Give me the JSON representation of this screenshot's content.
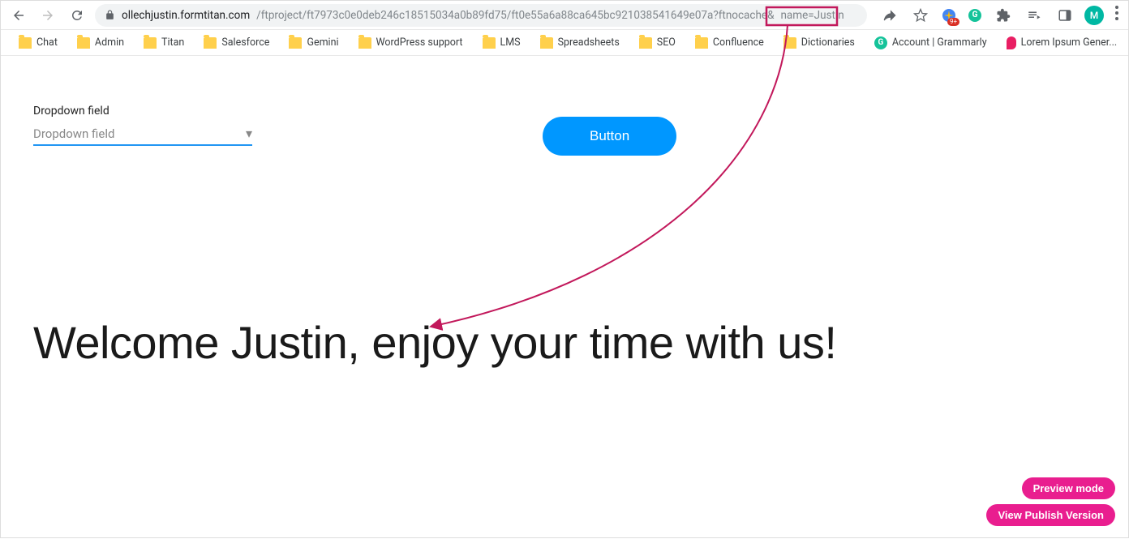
{
  "browser": {
    "url_host": "ollechjustin.formtitan.com",
    "url_path": "/ftproject/ft7973c0e0deb246c18515034a0b89fd75/ft0e55a6a88ca645bc921038541649e07a?ftnocache&",
    "url_query_highlight": "name=Justin",
    "avatar_initial": "M",
    "ext_badge": "9+"
  },
  "bookmarks": [
    {
      "label": "Chat",
      "icon": "folder"
    },
    {
      "label": "Admin",
      "icon": "folder"
    },
    {
      "label": "Titan",
      "icon": "folder"
    },
    {
      "label": "Salesforce",
      "icon": "folder"
    },
    {
      "label": "Gemini",
      "icon": "folder"
    },
    {
      "label": "WordPress support",
      "icon": "folder"
    },
    {
      "label": "LMS",
      "icon": "folder"
    },
    {
      "label": "Spreadsheets",
      "icon": "folder"
    },
    {
      "label": "SEO",
      "icon": "folder"
    },
    {
      "label": "Confluence",
      "icon": "folder"
    },
    {
      "label": "Dictionaries",
      "icon": "folder"
    },
    {
      "label": "Account | Grammarly",
      "icon": "grammarly"
    },
    {
      "label": "Lorem Ipsum Gener...",
      "icon": "pin"
    }
  ],
  "form": {
    "dropdown_label": "Dropdown field",
    "dropdown_placeholder": "Dropdown field",
    "button_label": "Button"
  },
  "welcome_text": "Welcome Justin, enjoy your time with us!",
  "floating": {
    "preview": "Preview mode",
    "publish": "View Publish Version"
  }
}
